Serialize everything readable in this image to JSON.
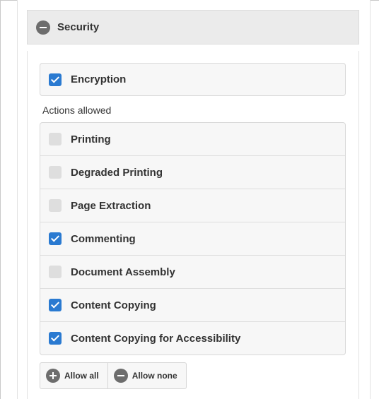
{
  "section": {
    "title": "Security",
    "toggle_icon": "minus-circle-icon"
  },
  "encryption": {
    "label": "Encryption",
    "checked": true
  },
  "actions": {
    "caption": "Actions allowed",
    "items": [
      {
        "label": "Printing",
        "checked": false
      },
      {
        "label": "Degraded Printing",
        "checked": false
      },
      {
        "label": "Page Extraction",
        "checked": false
      },
      {
        "label": "Commenting",
        "checked": true
      },
      {
        "label": "Document Assembly",
        "checked": false
      },
      {
        "label": "Content Copying",
        "checked": true
      },
      {
        "label": "Content Copying for Accessibility",
        "checked": true
      }
    ]
  },
  "buttons": {
    "allow_all": {
      "label": "Allow all",
      "icon": "plus-circle-icon"
    },
    "allow_none": {
      "label": "Allow none",
      "icon": "minus-circle-icon"
    }
  },
  "colors": {
    "checkbox_checked": "#2a7ad1",
    "checkbox_unchecked": "#dedede",
    "header_bg": "#ebebeb",
    "icon_gray": "#6d6d6d"
  }
}
